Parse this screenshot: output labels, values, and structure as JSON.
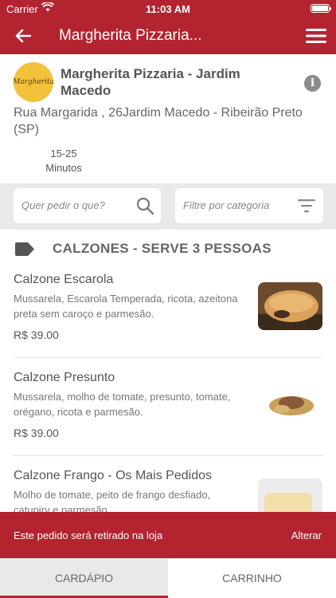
{
  "status_bar": {
    "carrier": "Carrier",
    "time": "11:03 AM"
  },
  "nav": {
    "title": "Margherita Pizzaria..."
  },
  "store": {
    "logo_text": "Margherita",
    "name": "Margherita Pizzaria - Jardim Macedo",
    "address": "Rua Margarida , 26Jardim Macedo - Ribeirão Preto  (SP)",
    "time_range": "15-25",
    "time_unit": "Minutos"
  },
  "filters": {
    "search_placeholder": "Quer pedir o que?",
    "category_placeholder": "Filtre por categoria"
  },
  "section": {
    "title": "CALZONES - SERVE 3 PESSOAS"
  },
  "products": [
    {
      "name": "Calzone Escarola",
      "description": "Mussarela, Escarola Temperada, ricota, azeitona preta sem caroço e parmesão.",
      "price": "R$ 39.00"
    },
    {
      "name": "Calzone Presunto",
      "description": "Mussarela, molho de tomate, presunto, tomate, orégano, ricota e parmesão.",
      "price": "R$ 39.00"
    },
    {
      "name": "Calzone Frango - Os Mais Pedidos",
      "description": "Molho de tomate, peito de frango desfiado, catupiry e parmesão.",
      "price": ""
    }
  ],
  "banner": {
    "message": "Este pedido será retirado na loja",
    "action": "Alterar"
  },
  "tabs": [
    {
      "label": "CARDÁPIO",
      "active": true
    },
    {
      "label": "CARRINHO",
      "active": false
    }
  ],
  "colors": {
    "brand": "#b32430",
    "filter_bg": "#e9e9e9",
    "logo_bg": "#f2c23a"
  }
}
